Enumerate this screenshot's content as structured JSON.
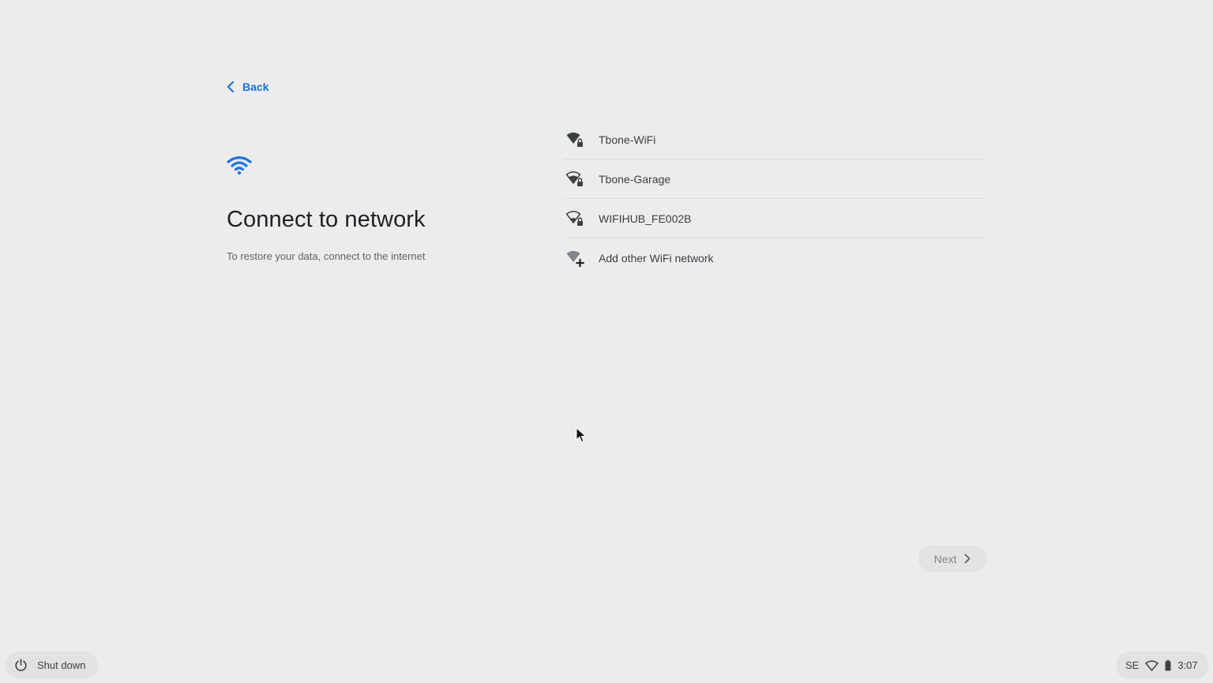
{
  "header": {
    "back_label": "Back"
  },
  "hero": {
    "icon": "wifi-icon",
    "title": "Connect to network",
    "subtitle": "To restore your data, connect to the internet"
  },
  "networks": [
    {
      "name": "Tbone-WiFi",
      "icon": "wifi-lock-icon",
      "signal": "full"
    },
    {
      "name": "Tbone-Garage",
      "icon": "wifi-lock-icon",
      "signal": "medium"
    },
    {
      "name": "WIFIHUB_FE002B",
      "icon": "wifi-lock-icon",
      "signal": "low"
    }
  ],
  "add_network": {
    "label": "Add other WiFi network",
    "icon": "wifi-add-icon"
  },
  "footer": {
    "next_label": "Next",
    "shutdown_label": "Shut down"
  },
  "status_tray": {
    "keyboard_layout": "SE",
    "time": "3:07"
  },
  "colors": {
    "background": "#ececec",
    "accent": "#1a73e8",
    "text": "#3c4043"
  }
}
